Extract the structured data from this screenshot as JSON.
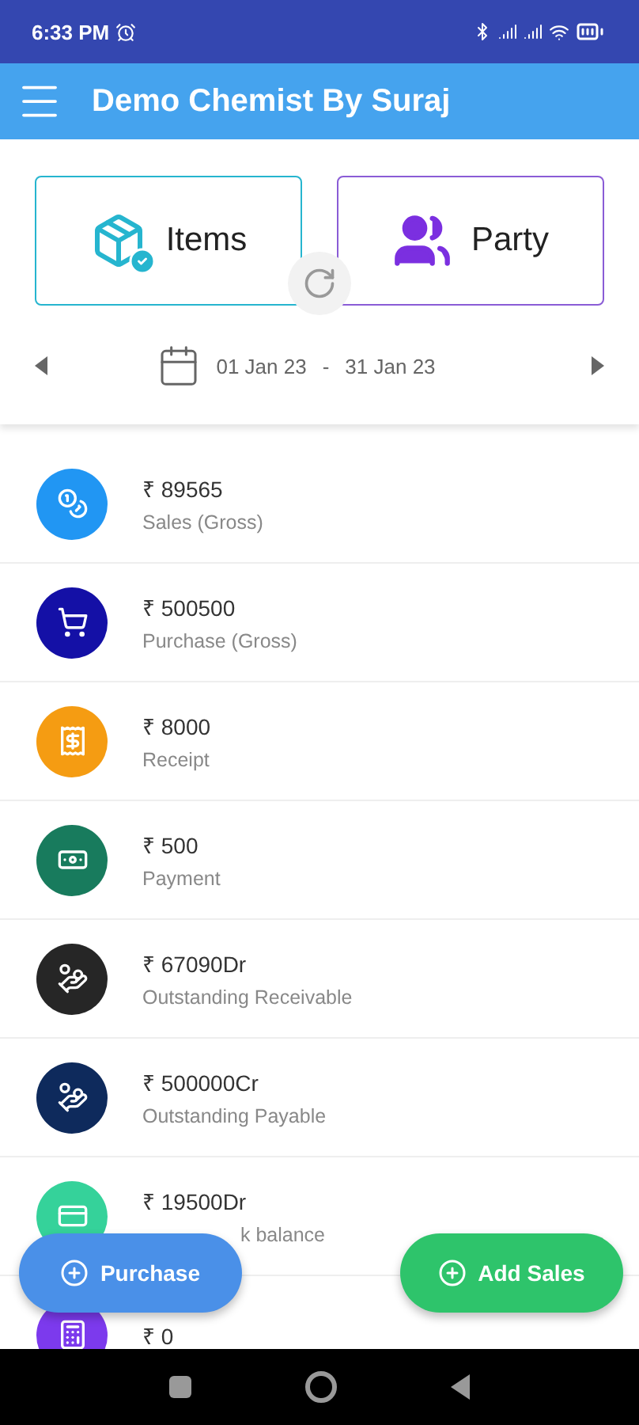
{
  "status_bar": {
    "time": "6:33 PM"
  },
  "app_bar": {
    "title": "Demo Chemist By Suraj"
  },
  "cards": [
    {
      "label": "Items",
      "color": "#26b5cf"
    },
    {
      "label": "Party",
      "color": "#8a5cd6"
    }
  ],
  "date_range": {
    "from": "01 Jan 23",
    "separator": "-",
    "to": "31 Jan 23"
  },
  "rows": [
    {
      "kind": "full",
      "value": "₹ 89565",
      "label": "Sales (Gross)",
      "color": "#2196f3"
    },
    {
      "kind": "full",
      "value": "₹ 500500",
      "label": "Purchase (Gross)",
      "color": "#1410a6"
    },
    {
      "kind": "full",
      "value": "₹ 8000",
      "label": "Receipt",
      "color": "#f59c12"
    },
    {
      "kind": "full",
      "value": "₹ 500",
      "label": "Payment",
      "color": "#187b5d"
    },
    {
      "kind": "full",
      "value": "₹ 67090Dr",
      "label": "Outstanding Receivable",
      "color": "#262626"
    },
    {
      "kind": "full",
      "value": "₹ 500000Cr",
      "label": "Outstanding Payable",
      "color": "#0e2a5c"
    },
    {
      "kind": "cut",
      "value": "₹ 19500Dr",
      "label": "k balance",
      "color": "#35d29a"
    },
    {
      "value": "₹ 0",
      "color": "#7c3aed"
    }
  ],
  "fabs": [
    {
      "label": "Purchase",
      "color": "#4a90e8"
    },
    {
      "label": "Add Sales",
      "color": "#2ec46b"
    }
  ]
}
